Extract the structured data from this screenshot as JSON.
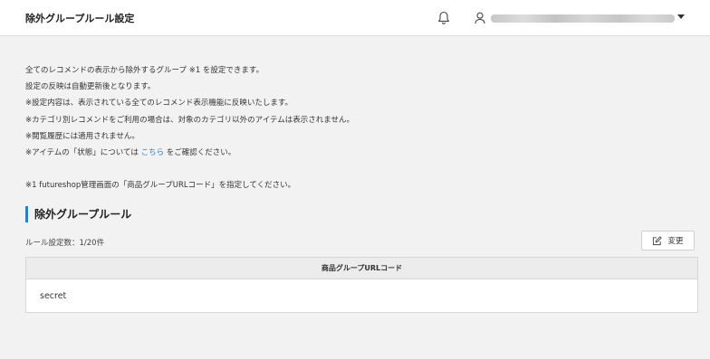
{
  "header": {
    "title": "除外グループルール設定",
    "icons": {
      "notifications": "bell-icon",
      "user": "user-icon",
      "menu": "chevron-down-icon"
    }
  },
  "description": {
    "lines": [
      "全てのレコメンドの表示から除外するグループ ※1 を設定できます。",
      "設定の反映は自動更新後となります。",
      "※設定内容は、表示されている全てのレコメンド表示機能に反映いたします。",
      "※カテゴリ別レコメンドをご利用の場合は、対象のカテゴリ以外のアイテムは表示されません。",
      "※閲覧履歴には適用されません。"
    ],
    "status_line": {
      "before": "※アイテムの「状態」については ",
      "link": "こちら",
      "after": " をご確認ください。"
    },
    "footnote": "※1 futureshop管理画面の「商品グループURLコード」を指定してください。"
  },
  "section": {
    "title": "除外グループルール",
    "rule_count": "ルール設定数：1/20件",
    "edit_button": "変更",
    "table": {
      "header": "商品グループURLコード",
      "rows": [
        "secret"
      ]
    }
  },
  "colors": {
    "accent": "#2a7fc9",
    "background": "#f2f2f2"
  }
}
